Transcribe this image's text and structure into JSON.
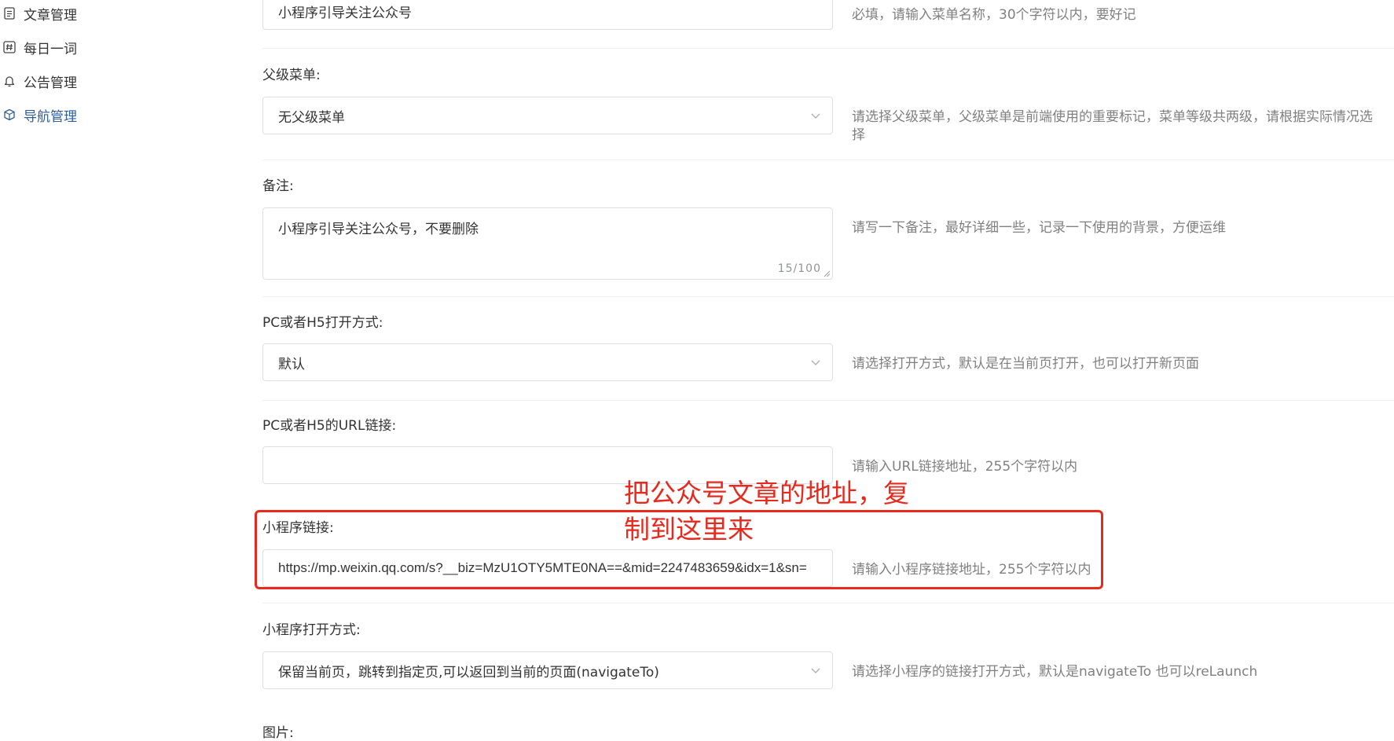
{
  "sidebar": {
    "items": [
      {
        "label": "文章管理",
        "icon": "document-icon"
      },
      {
        "label": "每日一词",
        "icon": "hash-icon"
      },
      {
        "label": "公告管理",
        "icon": "bell-icon"
      },
      {
        "label": "导航管理",
        "icon": "box-icon",
        "active": true
      }
    ]
  },
  "form": {
    "menu_name": {
      "value": "小程序引导关注公众号",
      "hint": "必填，请输入菜单名称，30个字符以内，要好记"
    },
    "parent_menu": {
      "label": "父级菜单:",
      "value": "无父级菜单",
      "hint_line1": "请选择父级菜单，父级菜单是前端使用的重要标记，菜单等级共两级，请根据实际情况选",
      "hint_line2": "择"
    },
    "remark": {
      "label": "备注:",
      "value": "小程序引导关注公众号，不要删除",
      "counter": "15/100",
      "hint": "请写一下备注，最好详细一些，记录一下使用的背景，方便运维"
    },
    "open_mode": {
      "label": "PC或者H5打开方式:",
      "value": "默认",
      "hint": "请选择打开方式，默认是在当前页打开，也可以打开新页面"
    },
    "url_link": {
      "label": "PC或者H5的URL链接:",
      "value": "",
      "hint": "请输入URL链接地址，255个字符以内"
    },
    "mp_link": {
      "label": "小程序链接:",
      "value": "https://mp.weixin.qq.com/s?__biz=MzU1OTY5MTE0NA==&mid=2247483659&idx=1&sn=",
      "hint": "请输入小程序链接地址，255个字符以内"
    },
    "mp_open_mode": {
      "label": "小程序打开方式:",
      "value": "保留当前页，跳转到指定页,可以返回到当前的页面(navigateTo)",
      "hint": "请选择小程序的链接打开方式，默认是navigateTo 也可以reLaunch"
    },
    "image": {
      "label": "图片:"
    }
  },
  "annotation": {
    "text": "把公众号文章的地址，复制到这里来",
    "color": "#e8291d"
  },
  "colors": {
    "accent": "#2f5d9a",
    "border": "#dcdfe6",
    "hint": "#808080"
  }
}
